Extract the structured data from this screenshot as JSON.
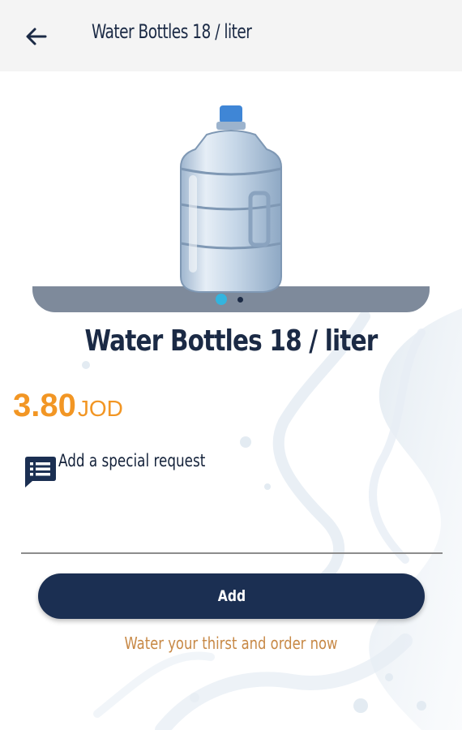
{
  "header": {
    "title": "Water Bottles 18 / liter",
    "back_icon": "arrow-left-icon"
  },
  "carousel": {
    "image": "water-bottle-18l",
    "slide_count": 2,
    "active_slide": 1
  },
  "product": {
    "name": "Water Bottles 18 / liter",
    "price": "3.80",
    "currency": "JOD"
  },
  "special_request": {
    "icon": "note-list-icon",
    "label": "Add a special request",
    "value": "",
    "placeholder": ""
  },
  "actions": {
    "add_label": "Add"
  },
  "tagline": "Water your thirst and order now",
  "colors": {
    "primary": "#1b2f52",
    "accent": "#f29624",
    "dot_active": "#33b4de",
    "tagline": "#c78845",
    "shelf": "#7e8a9b"
  }
}
